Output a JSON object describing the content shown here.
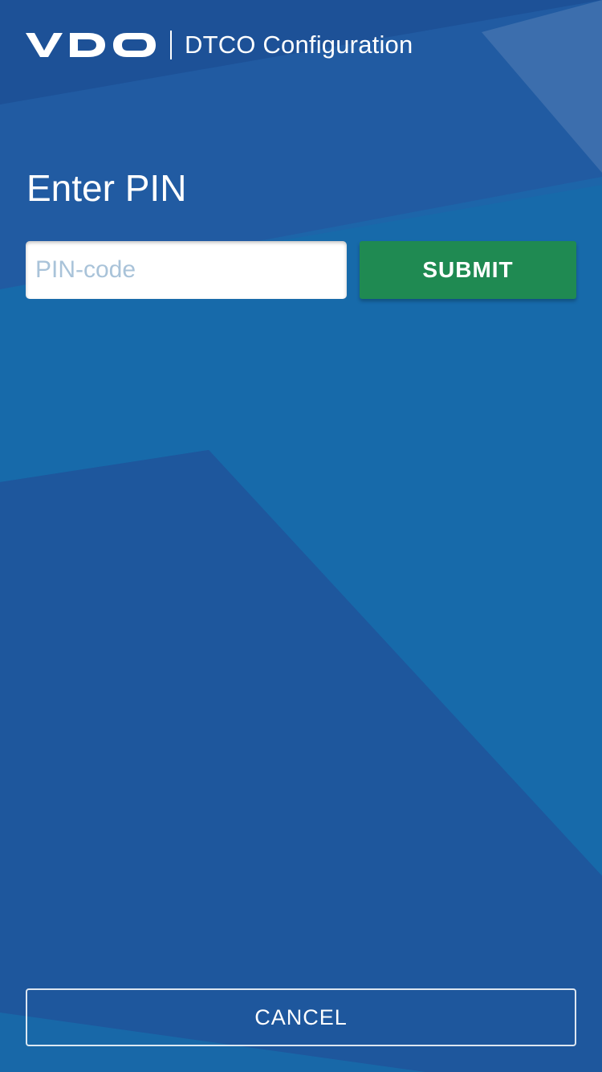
{
  "header": {
    "brand": "VDO",
    "app_title": "DTCO Configuration"
  },
  "main": {
    "title": "Enter PIN",
    "pin_input": {
      "placeholder": "PIN-code",
      "value": ""
    },
    "submit_label": "SUBMIT"
  },
  "footer": {
    "cancel_label": "CANCEL"
  },
  "colors": {
    "background_dark": "#1f559c",
    "background_light": "#176aaa",
    "submit_green": "#1f8a52",
    "placeholder": "#a9c3d9",
    "text": "#ffffff"
  }
}
